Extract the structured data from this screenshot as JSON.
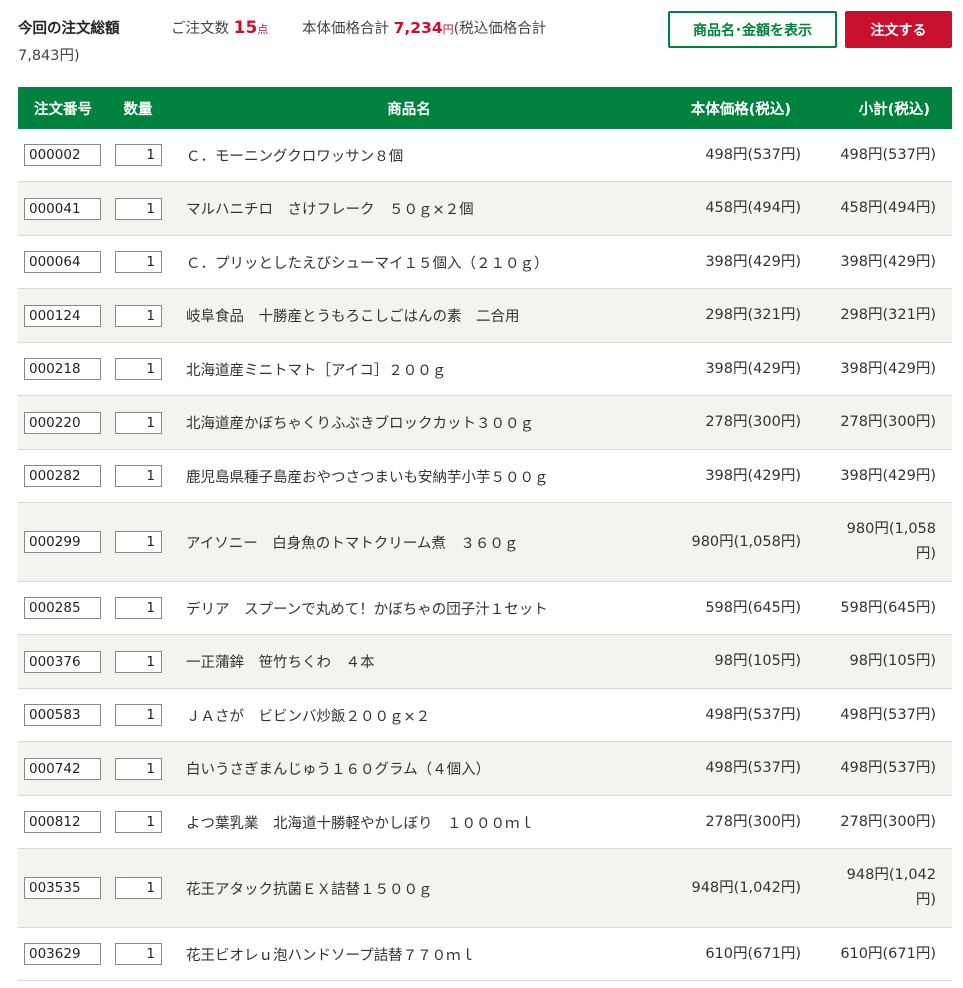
{
  "summary": {
    "title": "今回の注文総額",
    "count_label": "ご注文数",
    "count_value": "15",
    "count_unit": "点",
    "price_label": "本体価格合計",
    "price_value": "7,234",
    "price_unit": "円",
    "tax_prefix": "(税込価格合計",
    "tax_value": "7,843円)"
  },
  "buttons": {
    "show_label": "商品名･金額を表示",
    "order_label": "注文する"
  },
  "table": {
    "headers": {
      "id": "注文番号",
      "qty": "数量",
      "name": "商品名",
      "price": "本体価格(税込)",
      "subtotal": "小計(税込)"
    },
    "rows": [
      {
        "id": "000002",
        "qty": "1",
        "name": "Ｃ．モーニングクロワッサン８個",
        "price": "498円(537円)",
        "subtotal": "498円(537円)"
      },
      {
        "id": "000041",
        "qty": "1",
        "name": "マルハニチロ　さけフレーク　５０ｇ×２個",
        "price": "458円(494円)",
        "subtotal": "458円(494円)"
      },
      {
        "id": "000064",
        "qty": "1",
        "name": "Ｃ．プリッとしたえびシューマイ１５個入（２１０ｇ）",
        "price": "398円(429円)",
        "subtotal": "398円(429円)"
      },
      {
        "id": "000124",
        "qty": "1",
        "name": "岐阜食品　十勝産とうもろこしごはんの素　二合用",
        "price": "298円(321円)",
        "subtotal": "298円(321円)"
      },
      {
        "id": "000218",
        "qty": "1",
        "name": "北海道産ミニトマト［アイコ］２００ｇ",
        "price": "398円(429円)",
        "subtotal": "398円(429円)"
      },
      {
        "id": "000220",
        "qty": "1",
        "name": "北海道産かぼちゃくりふぶきブロックカット３００ｇ",
        "price": "278円(300円)",
        "subtotal": "278円(300円)"
      },
      {
        "id": "000282",
        "qty": "1",
        "name": "鹿児島県種子島産おやつさつまいも安納芋小芋５００ｇ",
        "price": "398円(429円)",
        "subtotal": "398円(429円)"
      },
      {
        "id": "000299",
        "qty": "1",
        "name": "アイソニー　白身魚のトマトクリーム煮　３６０ｇ",
        "price": "980円(1,058円)",
        "subtotal": "980円(1,058円)"
      },
      {
        "id": "000285",
        "qty": "1",
        "name": "デリア　スプーンで丸めて！かぼちゃの団子汁１セット",
        "price": "598円(645円)",
        "subtotal": "598円(645円)"
      },
      {
        "id": "000376",
        "qty": "1",
        "name": "一正蒲鉾　笹竹ちくわ　４本",
        "price": "98円(105円)",
        "subtotal": "98円(105円)"
      },
      {
        "id": "000583",
        "qty": "1",
        "name": "ＪＡさが　ビビンバ炒飯２００ｇ×２",
        "price": "498円(537円)",
        "subtotal": "498円(537円)"
      },
      {
        "id": "000742",
        "qty": "1",
        "name": "白いうさぎまんじゅう１６０グラム（４個入）",
        "price": "498円(537円)",
        "subtotal": "498円(537円)"
      },
      {
        "id": "000812",
        "qty": "1",
        "name": "よつ葉乳業　北海道十勝軽やかしぼり　１０００ｍｌ",
        "price": "278円(300円)",
        "subtotal": "278円(300円)"
      },
      {
        "id": "003535",
        "qty": "1",
        "name": "花王アタック抗菌ＥＸ詰替１５００ｇ",
        "price": "948円(1,042円)",
        "subtotal": "948円(1,042円)"
      },
      {
        "id": "003629",
        "qty": "1",
        "name": "花王ビオレｕ泡ハンドソープ詰替７７０ｍｌ",
        "price": "610円(671円)",
        "subtotal": "610円(671円)"
      }
    ]
  }
}
